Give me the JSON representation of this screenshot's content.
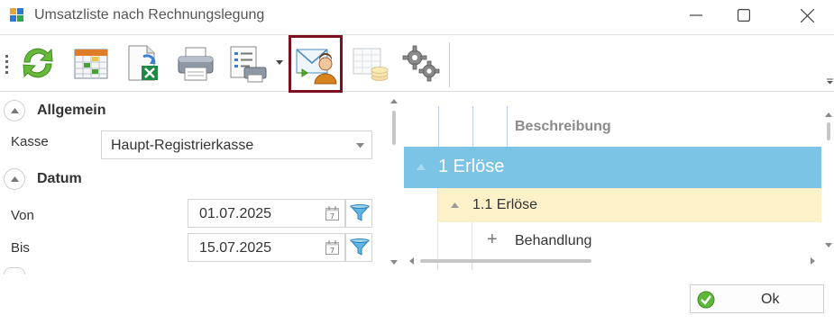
{
  "window": {
    "title": "Umsatzliste nach Rechnungslegung",
    "controls": [
      "minimize-icon",
      "maximize-icon",
      "close-icon"
    ]
  },
  "toolbar": {
    "items": [
      {
        "name": "refresh-icon",
        "selected": false
      },
      {
        "name": "calendar-grid-icon",
        "selected": false
      },
      {
        "name": "excel-export-icon",
        "selected": false
      },
      {
        "name": "printer-icon",
        "selected": false
      },
      {
        "name": "print-list-icon",
        "selected": false,
        "has_dropdown": true
      },
      {
        "name": "email-contact-icon",
        "selected": true
      },
      {
        "name": "table-coins-icon",
        "selected": false,
        "disabled": true
      },
      {
        "name": "settings-gears-icon",
        "selected": false
      }
    ],
    "accent_selected": "#7c1020"
  },
  "filters": {
    "allgemein": {
      "title": "Allgemein",
      "kasse_label": "Kasse",
      "kasse_value": "Haupt-Registrierkasse"
    },
    "datum": {
      "title": "Datum",
      "von_label": "Von",
      "von_value": "01.07.2025",
      "bis_label": "Bis",
      "bis_value": "15.07.2025"
    }
  },
  "grid": {
    "header": "Beschreibung",
    "rows": [
      {
        "level": 0,
        "label": "1 Erlöse",
        "expanded": true,
        "color": "#7cc4e6"
      },
      {
        "level": 1,
        "label": "1.1 Erlöse",
        "expanded": true,
        "color": "#fdf1c9"
      },
      {
        "level": 2,
        "label": "Behandlung",
        "expanded": false
      }
    ]
  },
  "footer": {
    "ok_label": "Ok"
  }
}
